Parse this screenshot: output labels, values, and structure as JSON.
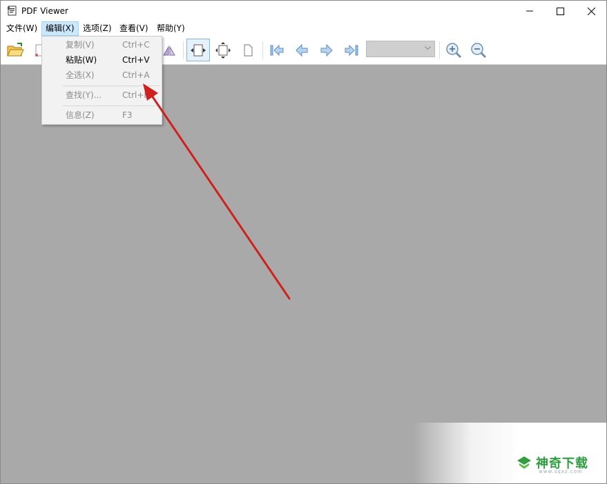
{
  "window": {
    "title": "PDF Viewer"
  },
  "menubar": {
    "items": [
      {
        "label": "文件(W)"
      },
      {
        "label": "编辑(X)"
      },
      {
        "label": "选项(Z)"
      },
      {
        "label": "查看(V)"
      },
      {
        "label": "帮助(Y)"
      }
    ]
  },
  "edit_menu": {
    "items": [
      {
        "label": "复制(V)",
        "shortcut": "Ctrl+C",
        "enabled": false
      },
      {
        "label": "粘贴(W)",
        "shortcut": "Ctrl+V",
        "enabled": true
      },
      {
        "label": "全选(X)",
        "shortcut": "Ctrl+A",
        "enabled": false
      },
      {
        "label": "查找(Y)...",
        "shortcut": "Ctrl+F",
        "enabled": false
      },
      {
        "label": "信息(Z)",
        "shortcut": "F3",
        "enabled": false
      }
    ]
  },
  "toolbar": {
    "icons": [
      "open-folder-icon",
      "page-icon",
      "rotate-icon",
      "fit-width-icon",
      "fit-page-icon",
      "single-page-icon",
      "first-page-icon",
      "previous-page-icon",
      "next-page-icon",
      "last-page-icon",
      "zoom-in-icon",
      "zoom-out-icon"
    ],
    "page_select_value": ""
  },
  "watermark": {
    "brand": "神奇下载",
    "sub": "www.sqxz.com"
  },
  "colors": {
    "doc_background": "#a9a9a9",
    "menu_highlight": "#cce8ff",
    "annotation_arrow": "#d0201c",
    "watermark_green": "#2e9e3e"
  }
}
